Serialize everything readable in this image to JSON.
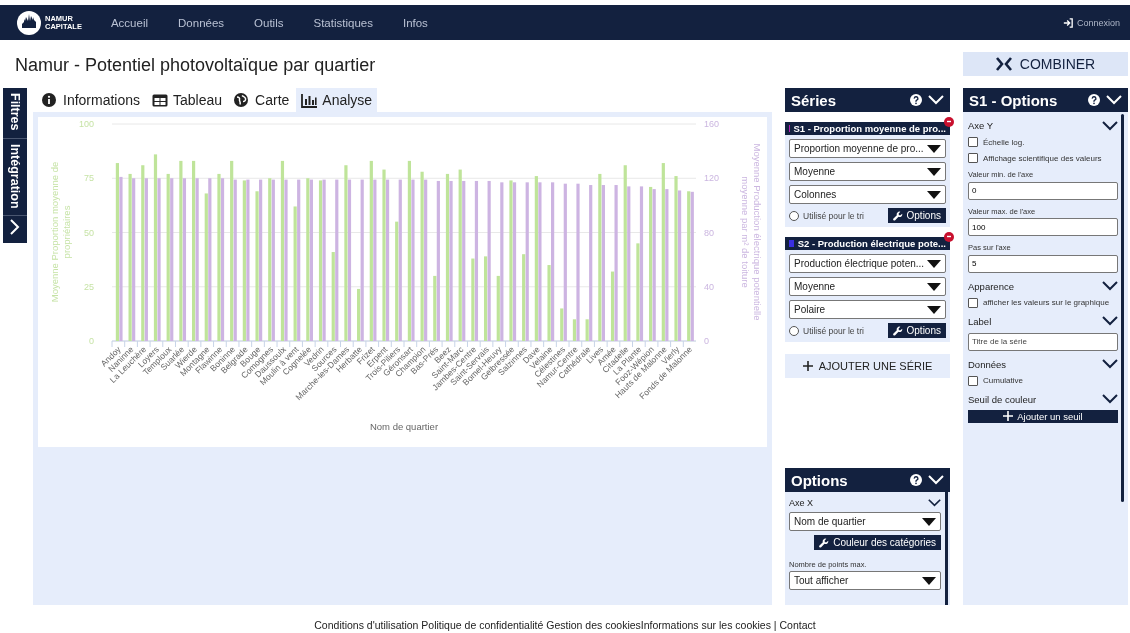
{
  "nav": {
    "logo_lines": [
      "NAMUR",
      "CAPITALE"
    ],
    "items": [
      "Accueil",
      "Données",
      "Outils",
      "Statistiques",
      "Infos"
    ],
    "login": "Connexion"
  },
  "title": "Namur - Potentiel photovoltaïque par quartier",
  "combine_button": "COMBINER",
  "side_tabs": [
    "Filtres",
    "Intégration"
  ],
  "tabs": [
    {
      "label": "Informations",
      "selected": false
    },
    {
      "label": "Tableau",
      "selected": false
    },
    {
      "label": "Carte",
      "selected": false
    },
    {
      "label": "Analyse",
      "selected": true
    }
  ],
  "chart": {
    "chart_data": {
      "type": "bar",
      "grid": true,
      "xlabel": "Nom de quartier",
      "ylabel": "Moyenne Proportion moyenne de propriétaires",
      "y2label": "Moyenne Production électrique potentielle moyenne par m² de toiture",
      "ylim": [
        0,
        100
      ],
      "yticks": [
        0,
        25,
        50,
        75,
        100
      ],
      "y2lim": [
        0,
        160
      ],
      "y2ticks": [
        0,
        40,
        80,
        120,
        160
      ],
      "categories": [
        "Andoy",
        "Naninne",
        "La Leuchère",
        "Loyers",
        "Temploux",
        "Suarlée",
        "Wierde",
        "Montagne",
        "Flawinne",
        "Boninne",
        "Belgrade",
        "Bouge",
        "Comognes",
        "Daussoulx",
        "Moulin à vent",
        "Cognelée",
        "Vedrin",
        "Sources",
        "Marche-les-Dames",
        "Herbatte",
        "Frizet",
        "Erpent",
        "Trois-Piliers",
        "Géronsart",
        "Champion",
        "Bas-Prés",
        "Beez",
        "Saint-Marc",
        "Jambes-Centre",
        "Saint-Servais",
        "Bomel-Heuvy",
        "Gelbressée",
        "Salzinnes",
        "Dave",
        "Velaine",
        "Célestines",
        "Namur-Centre",
        "Cathédrale",
        "Lives",
        "Amée",
        "Citadelle",
        "La Plante",
        "Fooz-Wépion",
        "Hauts de Malonne",
        "Vierly",
        "Fonds de Malonne"
      ],
      "series": [
        {
          "color": "#bfe49a",
          "values": [
            82,
            77,
            81,
            86,
            77,
            83,
            83,
            68,
            77,
            83,
            74,
            69,
            75,
            83,
            62,
            75,
            74,
            41,
            81,
            24,
            83,
            79,
            55,
            83,
            78,
            30,
            77,
            79,
            38,
            39,
            30,
            74,
            40,
            76,
            35,
            15,
            10,
            10,
            77,
            32,
            81,
            45,
            71,
            82,
            76,
            69
          ]
        },
        {
          "color": "#cdb4e2",
          "axis": "y2",
          "values": [
            121,
            120,
            120,
            120,
            120,
            120,
            120,
            120,
            120,
            119,
            119,
            119,
            119,
            119,
            119,
            119,
            119,
            119,
            119,
            119,
            119,
            119,
            119,
            119,
            119,
            118,
            118,
            118,
            118,
            118,
            117,
            117,
            117,
            117,
            117,
            116,
            116,
            115,
            115,
            115,
            114,
            114,
            112,
            112,
            111,
            110
          ]
        }
      ]
    }
  },
  "series_panel": {
    "title": "Séries",
    "series": [
      {
        "label": "S1 - Proportion moyenne de pro...",
        "color": "#b41fb4",
        "selects": [
          "Proportion moyenne de pro...",
          "Moyenne",
          "Colonnes"
        ],
        "sort_label": "Utilisé pour le tri",
        "sort_selected": false,
        "options_button": "Options"
      },
      {
        "label": "S2 - Production électrique pote...",
        "color": "#3a2fe0",
        "selects": [
          "Production électrique poten...",
          "Moyenne",
          "Polaire"
        ],
        "sort_label": "Utilisé pour le tri",
        "sort_selected": false,
        "options_button": "Options"
      }
    ],
    "add_button": "AJOUTER UNE SÉRIE"
  },
  "options_panel": {
    "title": "Options",
    "axis_title": "Axe X",
    "axis_select": "Nom de quartier",
    "colors_button": "Couleur des catégories",
    "max_points_label": "Nombre de points max.",
    "max_points_select": "Tout afficher"
  },
  "series_options": {
    "title": "S1 - Options",
    "sections": [
      {
        "title": "Axe Y",
        "items": [
          {
            "kind": "checkbox",
            "label": "Échelle log.",
            "checked": false
          },
          {
            "kind": "checkbox",
            "label": "Affichage scientifique des valeurs",
            "checked": false
          },
          {
            "kind": "field",
            "label": "Valeur min. de l'axe",
            "value": "0"
          },
          {
            "kind": "field",
            "label": "Valeur max. de l'axe",
            "value": "100"
          },
          {
            "kind": "field",
            "label": "Pas sur l'axe",
            "value": "5"
          }
        ]
      },
      {
        "title": "Apparence",
        "items": [
          {
            "kind": "checkbox",
            "label": "afficher les valeurs sur le graphique",
            "checked": false
          }
        ]
      },
      {
        "title": "Label",
        "items": [
          {
            "kind": "field",
            "placeholder": "Titre de la série"
          }
        ]
      },
      {
        "title": "Données",
        "items": [
          {
            "kind": "checkbox",
            "label": "Cumulative",
            "checked": false
          }
        ]
      },
      {
        "title": "Seuil de couleur",
        "items": [
          {
            "kind": "button",
            "label": "Ajouter un seuil"
          }
        ]
      }
    ]
  },
  "footer": "Conditions d'utilisation Politique de confidentialité Gestion des cookiesInformations sur les cookies | Contact"
}
